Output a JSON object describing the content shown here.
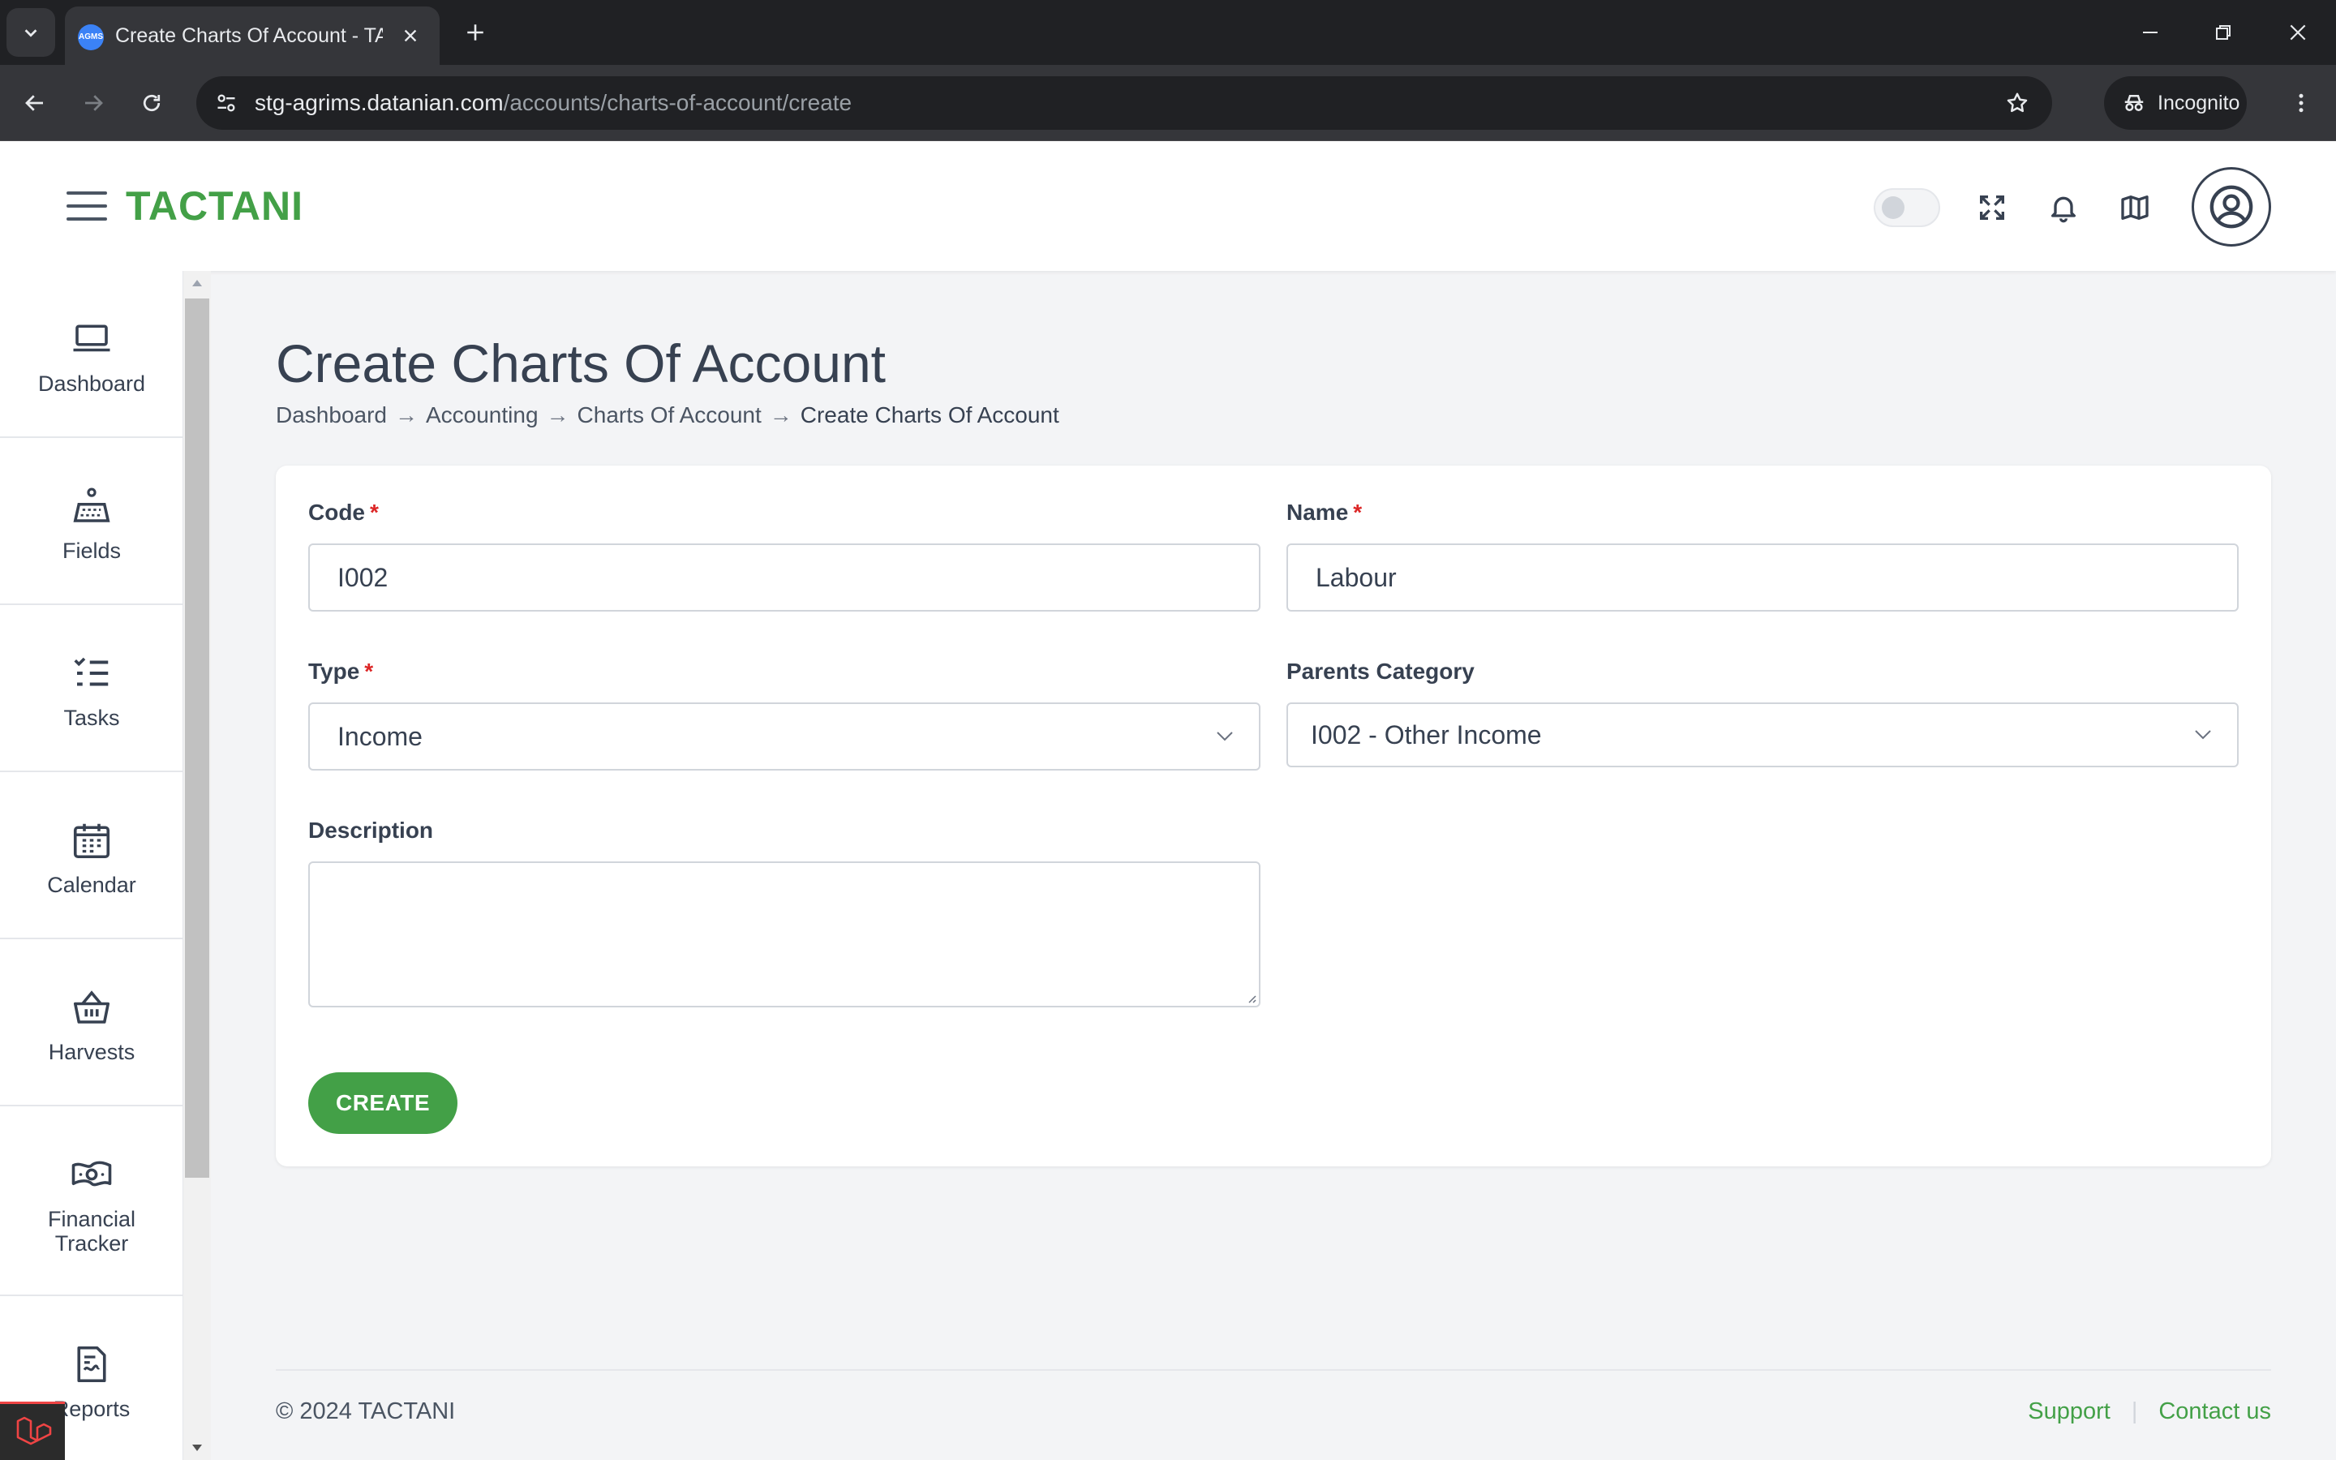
{
  "browser": {
    "tab_title": "Create Charts Of Account - TACTANI",
    "favicon_text": "AGMS",
    "url_host": "stg-agrims.datanian.com",
    "url_path": "/accounts/charts-of-account/create",
    "incognito_label": "Incognito"
  },
  "header": {
    "brand": "TACTANI",
    "theme_toggle_on": false
  },
  "sidebar": {
    "items": [
      {
        "label": "Dashboard",
        "icon": "laptop-icon"
      },
      {
        "label": "Fields",
        "icon": "field-icon"
      },
      {
        "label": "Tasks",
        "icon": "checklist-icon"
      },
      {
        "label": "Calendar",
        "icon": "calendar-icon"
      },
      {
        "label": "Harvests",
        "icon": "basket-icon"
      },
      {
        "label": "Financial Tracker",
        "icon": "money-icon"
      },
      {
        "label": "Reports",
        "icon": "report-icon"
      }
    ]
  },
  "page": {
    "title": "Create Charts Of Account",
    "breadcrumb": [
      "Dashboard",
      "Accounting",
      "Charts Of Account",
      "Create Charts Of Account"
    ],
    "breadcrumb_separator": "→"
  },
  "form": {
    "code_label": "Code",
    "code_value": "I002",
    "name_label": "Name",
    "name_value": "Labour",
    "type_label": "Type",
    "type_value": "Income",
    "parent_label": "Parents Category",
    "parent_value": "I002 - Other Income",
    "description_label": "Description",
    "description_value": "",
    "required_marker": "*",
    "submit_label": "CREATE"
  },
  "footer": {
    "copyright": "© 2024 TACTANI",
    "links": [
      "Support",
      "Contact us"
    ],
    "separator": "|"
  },
  "colors": {
    "brand": "#43a047",
    "required": "#dc2626",
    "chrome_dark": "#202124"
  }
}
